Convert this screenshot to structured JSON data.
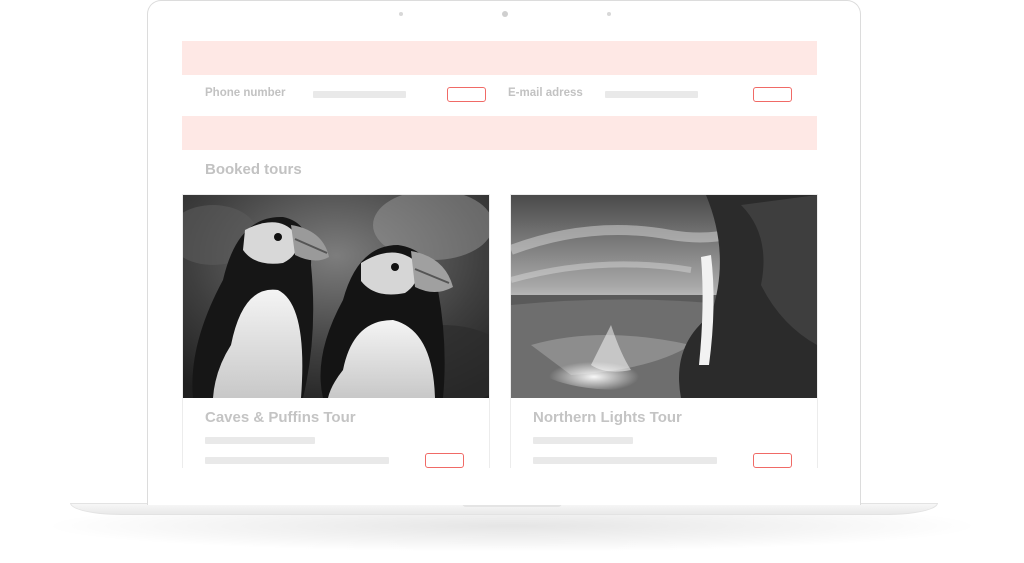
{
  "contact": {
    "phone_label": "Phone number",
    "email_label": "E-mail adress"
  },
  "tours": {
    "section_title": "Booked tours",
    "items": [
      {
        "title": "Caves & Puffins Tour",
        "image": "puffins-photo"
      },
      {
        "title": "Northern Lights Tour",
        "image": "waterfall-aurora-photo"
      }
    ]
  },
  "colors": {
    "band": "#fee8e5",
    "button_outline": "#f06a66",
    "placeholder_bar": "#e9e9e9",
    "label_text": "#c2c2c2"
  }
}
